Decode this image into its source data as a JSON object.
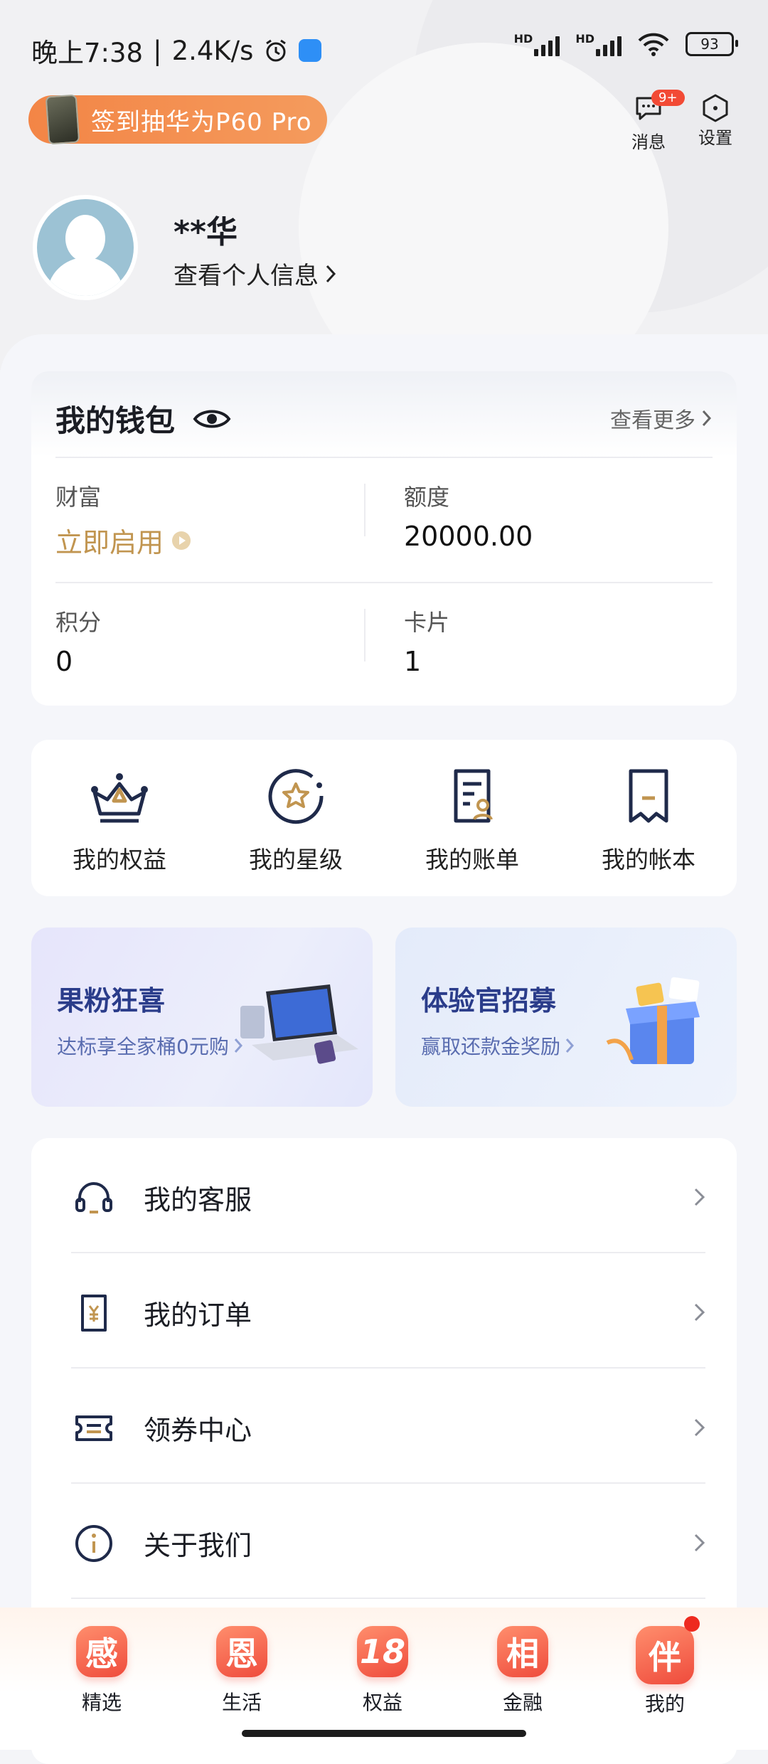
{
  "status_bar": {
    "time": "晚上7:38",
    "network_speed": "2.4K/s",
    "battery": "93",
    "signal_label": "HD"
  },
  "header": {
    "promo_text": "签到抽华为P60 Pro",
    "messages_label": "消息",
    "messages_badge": "9+",
    "settings_label": "设置",
    "user_name": "**华",
    "profile_link": "查看个人信息"
  },
  "wallet": {
    "title": "我的钱包",
    "more_label": "查看更多",
    "wealth_label": "财富",
    "wealth_value": "立即启用",
    "limit_label": "额度",
    "limit_value": "20000.00",
    "points_label": "积分",
    "points_value": "0",
    "cards_label": "卡片",
    "cards_value": "1"
  },
  "quick_actions": [
    {
      "label": "我的权益",
      "icon": "crown-icon"
    },
    {
      "label": "我的星级",
      "icon": "star-badge-icon"
    },
    {
      "label": "我的账单",
      "icon": "bill-icon"
    },
    {
      "label": "我的帐本",
      "icon": "ledger-icon"
    }
  ],
  "banners": [
    {
      "title": "果粉狂喜",
      "subtitle": "达标享全家桶0元购"
    },
    {
      "title": "体验官招募",
      "subtitle": "赢取还款金奖励"
    }
  ],
  "menu": [
    {
      "label": "我的客服",
      "icon": "headset-icon"
    },
    {
      "label": "我的订单",
      "icon": "order-icon"
    },
    {
      "label": "领券中心",
      "icon": "coupon-icon"
    },
    {
      "label": "关于我们",
      "icon": "info-icon"
    }
  ],
  "tabs": [
    {
      "char": "感",
      "label": "精选"
    },
    {
      "char": "恩",
      "label": "生活"
    },
    {
      "char": "18",
      "label": "权益"
    },
    {
      "char": "相",
      "label": "金融"
    },
    {
      "char": "伴",
      "label": "我的",
      "active": true
    }
  ],
  "colors": {
    "accent_orange": "#f38546",
    "gold": "#c19550",
    "brand_red": "#ef4b3c",
    "navy": "#1f2a4a"
  }
}
